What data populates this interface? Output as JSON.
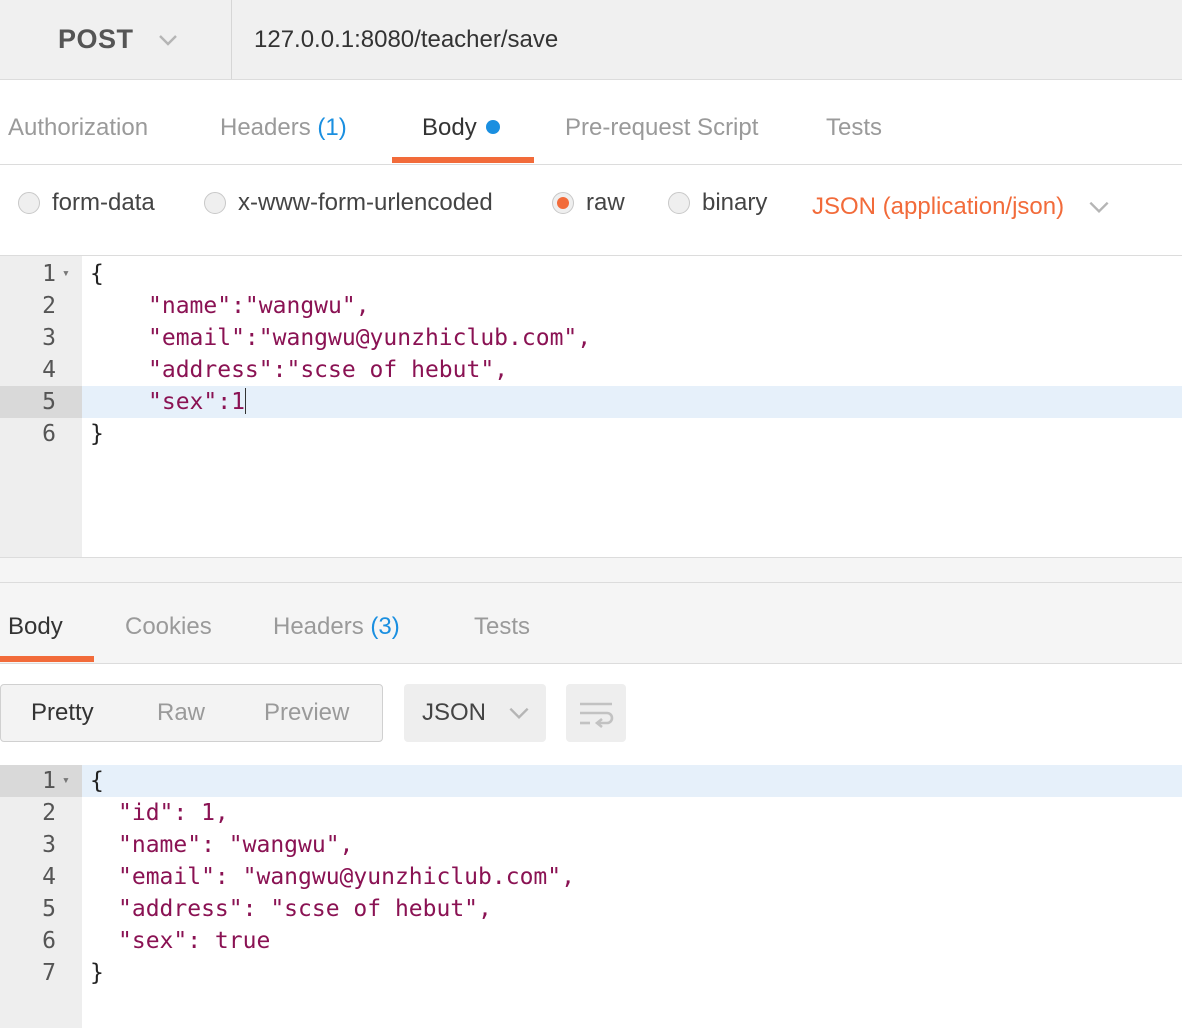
{
  "request": {
    "method": "POST",
    "url": "127.0.0.1:8080/teacher/save"
  },
  "request_tabs": {
    "authorization": "Authorization",
    "headers": "Headers",
    "headers_count": "(1)",
    "body": "Body",
    "pre_request": "Pre-request Script",
    "tests": "Tests",
    "active": "Body"
  },
  "body_types": {
    "form_data": "form-data",
    "urlencoded": "x-www-form-urlencoded",
    "raw": "raw",
    "binary": "binary",
    "selected": "raw",
    "content_type": "JSON (application/json)"
  },
  "request_body": {
    "line_numbers": [
      "1",
      "2",
      "3",
      "4",
      "5",
      "6"
    ],
    "highlighted_line": "5",
    "lines": [
      "{",
      "\"name\":\"wangwu\",",
      "\"email\":\"wangwu@yunzhiclub.com\",",
      "\"address\":\"scse of hebut\",",
      "\"sex\":1",
      "}"
    ]
  },
  "response_tabs": {
    "body": "Body",
    "cookies": "Cookies",
    "headers": "Headers",
    "headers_count": "(3)",
    "tests": "Tests",
    "active": "Body"
  },
  "response_view": {
    "pretty": "Pretty",
    "raw": "Raw",
    "preview": "Preview",
    "active": "Pretty",
    "format": "JSON"
  },
  "response_body": {
    "line_numbers": [
      "1",
      "2",
      "3",
      "4",
      "5",
      "6",
      "7"
    ],
    "highlighted_line": "1",
    "lines": [
      "{",
      "\"id\": 1,",
      "\"name\": \"wangwu\",",
      "\"email\": \"wangwu@yunzhiclub.com\",",
      "\"address\": \"scse of hebut\",",
      "\"sex\": true",
      "}"
    ]
  },
  "colors": {
    "accent": "#f26b3a",
    "link_count": "#1a8fe0",
    "json_key": "#8a1253",
    "json_string": "#2121b8"
  }
}
